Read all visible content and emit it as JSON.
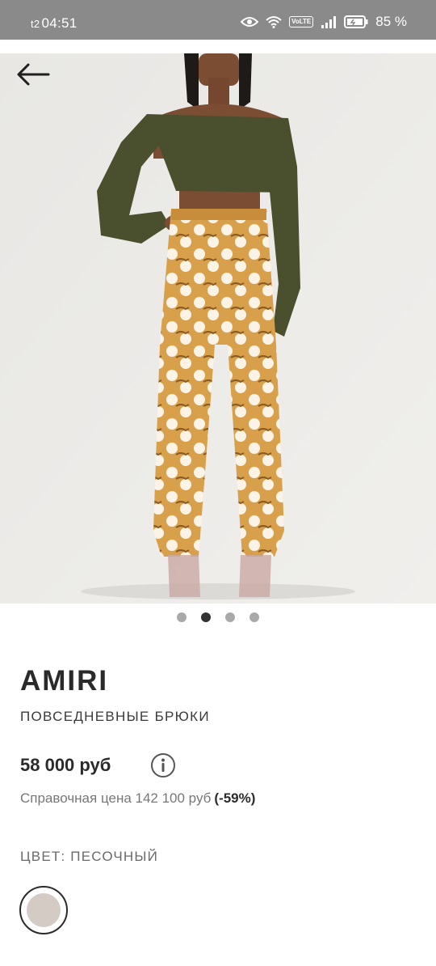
{
  "status_bar": {
    "carrier": "t2",
    "time": "04:51",
    "volte": "VoLTE",
    "battery": "85 %"
  },
  "product": {
    "brand": "AMIRI",
    "category": "ПОВСЕДНЕВНЫЕ БРЮКИ",
    "price": "58 000 руб",
    "reference_text": "Справочная цена 142 100 руб",
    "discount": "(-59%)",
    "color_label": "ЦВЕТ: ПЕСОЧНЫЙ",
    "swatch_color": "#d3cbc4"
  },
  "gallery": {
    "count": 4,
    "active_index": 1
  },
  "icons": {
    "back": "arrow-left-icon",
    "info": "info-circle-icon",
    "eye": "eye-icon",
    "wifi": "wifi-icon",
    "signal": "signal-icon",
    "battery": "battery-icon"
  }
}
